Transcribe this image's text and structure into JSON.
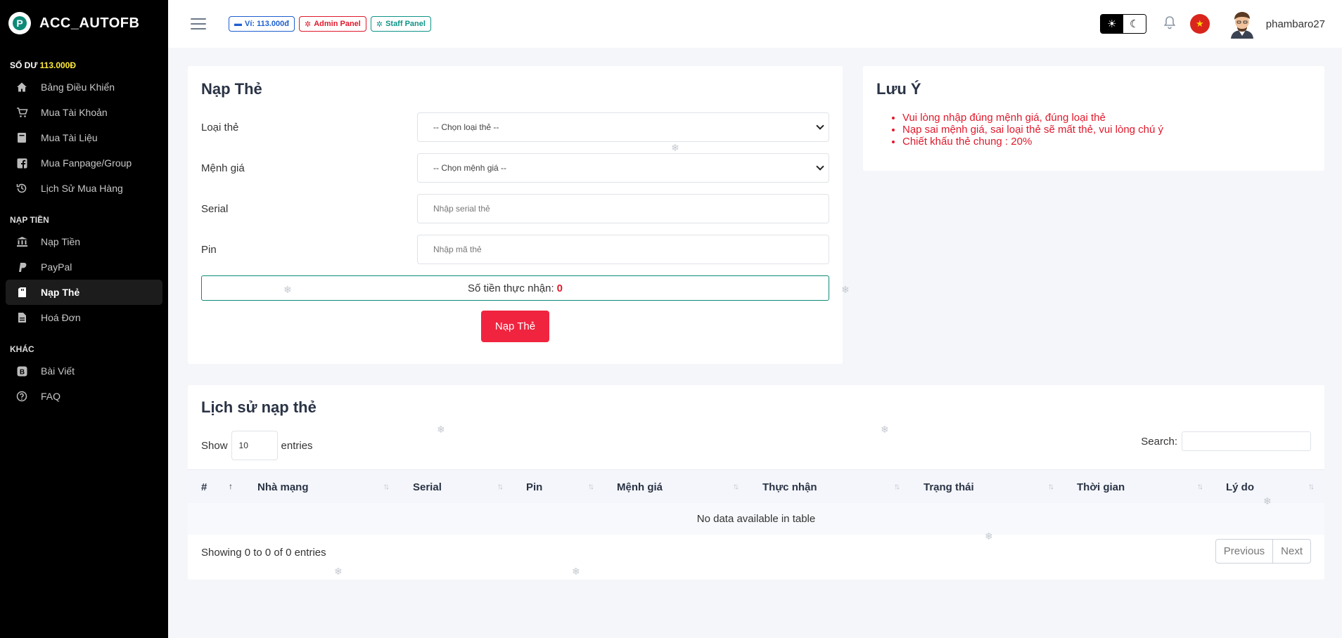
{
  "brand": {
    "name": "ACC_AUTOFB",
    "logo_letter": "P"
  },
  "sidebar": {
    "balance_label": "SỐ DƯ",
    "balance_value": "113.000Đ",
    "groups": [
      {
        "title": "",
        "items": [
          {
            "label": "Bảng Điều Khiển",
            "icon": "home-icon"
          },
          {
            "label": "Mua Tài Khoản",
            "icon": "cart-icon"
          },
          {
            "label": "Mua Tài Liệu",
            "icon": "book-icon"
          },
          {
            "label": "Mua Fanpage/Group",
            "icon": "facebook-icon"
          },
          {
            "label": "Lịch Sử Mua Hàng",
            "icon": "history-icon"
          }
        ]
      },
      {
        "title": "NẠP TIỀN",
        "items": [
          {
            "label": "Nạp Tiền",
            "icon": "bank-icon"
          },
          {
            "label": "PayPal",
            "icon": "paypal-icon"
          },
          {
            "label": "Nạp Thẻ",
            "icon": "card-icon",
            "active": true
          },
          {
            "label": "Hoá Đơn",
            "icon": "invoice-icon"
          }
        ]
      },
      {
        "title": "KHÁC",
        "items": [
          {
            "label": "Bài Viết",
            "icon": "blog-icon"
          },
          {
            "label": "FAQ",
            "icon": "question-icon"
          }
        ]
      }
    ]
  },
  "topbar": {
    "wallet_label": "Ví: 113.000đ",
    "admin_label": "Admin Panel",
    "staff_label": "Staff Panel",
    "username": "phambaro27"
  },
  "recharge_form": {
    "title": "Nạp Thẻ",
    "fields": [
      {
        "label": "Loại thẻ",
        "value": "-- Chọn loại thẻ --",
        "type": "select"
      },
      {
        "label": "Mệnh giá",
        "value": "-- Chọn mệnh giá --",
        "type": "select"
      },
      {
        "label": "Serial",
        "placeholder": "Nhập serial thẻ",
        "type": "input"
      },
      {
        "label": "Pin",
        "placeholder": "Nhập mã thẻ",
        "type": "input"
      }
    ],
    "receive_label": "Số tiền thực nhận:",
    "receive_value": "0",
    "submit_label": "Nạp Thẻ"
  },
  "notes": {
    "title": "Lưu Ý",
    "items": [
      "Vui lòng nhập đúng mệnh giá, đúng loại thẻ",
      "Nạp sai mệnh giá, sai loại thẻ sẽ mất thẻ, vui lòng chú ý",
      "Chiết khấu thẻ chung : 20%"
    ],
    "color": "#e0192b"
  },
  "history": {
    "title": "Lịch sử nạp thẻ",
    "show_label": "Show",
    "entries_count": "10",
    "entries_label": "entries",
    "search_label": "Search:",
    "columns": [
      "#",
      "Nhà mạng",
      "Serial",
      "Pin",
      "Mệnh giá",
      "Thực nhận",
      "Trạng thái",
      "Thời gian",
      "Lý do"
    ],
    "empty_text": "No data available in table",
    "showing_text": "Showing 0 to 0 of 0 entries",
    "prev_label": "Previous",
    "next_label": "Next"
  },
  "colors": {
    "accent": "#f0243f",
    "teal": "#0e8a78",
    "sidebar_bg": "#000000"
  }
}
